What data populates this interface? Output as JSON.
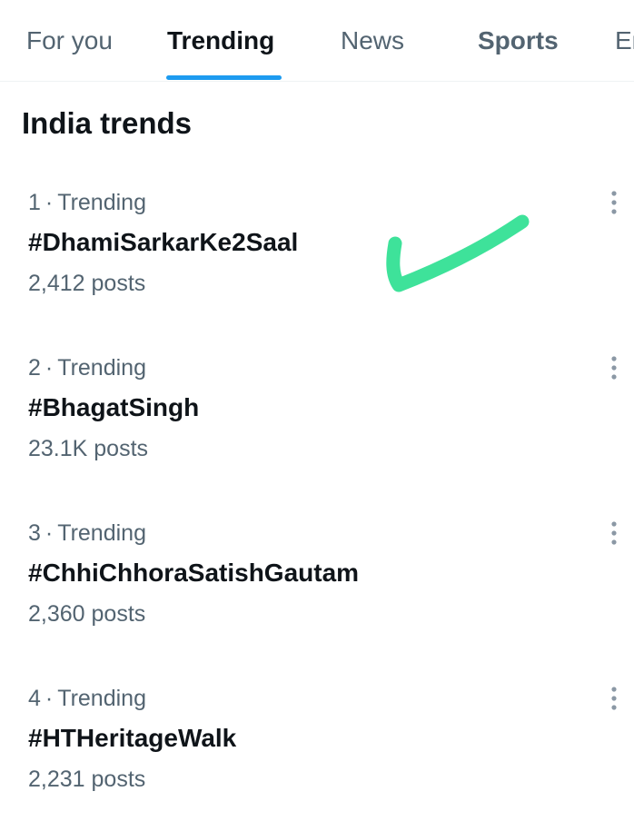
{
  "tabs": [
    {
      "label": "For you",
      "active": false
    },
    {
      "label": "Trending",
      "active": true
    },
    {
      "label": "News",
      "active": false
    },
    {
      "label": "Sports",
      "active": false
    },
    {
      "label": "En",
      "active": false
    }
  ],
  "section_title": "India trends",
  "trends": [
    {
      "rank": "1",
      "separator": "·",
      "category": "Trending",
      "name": "#DhamiSarkarKe2Saal",
      "posts": "2,412 posts"
    },
    {
      "rank": "2",
      "separator": "·",
      "category": "Trending",
      "name": "#BhagatSingh",
      "posts": "23.1K posts"
    },
    {
      "rank": "3",
      "separator": "·",
      "category": "Trending",
      "name": "#ChhiChhoraSatishGautam",
      "posts": "2,360 posts"
    },
    {
      "rank": "4",
      "separator": "·",
      "category": "Trending",
      "name": "#HTHeritageWalk",
      "posts": "2,231 posts"
    }
  ],
  "icons": {
    "more": "more-vertical-icon",
    "annotation": "checkmark-icon"
  },
  "colors": {
    "accent": "#1d9bf0",
    "checkmark": "#3ee29a",
    "text_primary": "#0f1419",
    "text_secondary": "#536471"
  }
}
